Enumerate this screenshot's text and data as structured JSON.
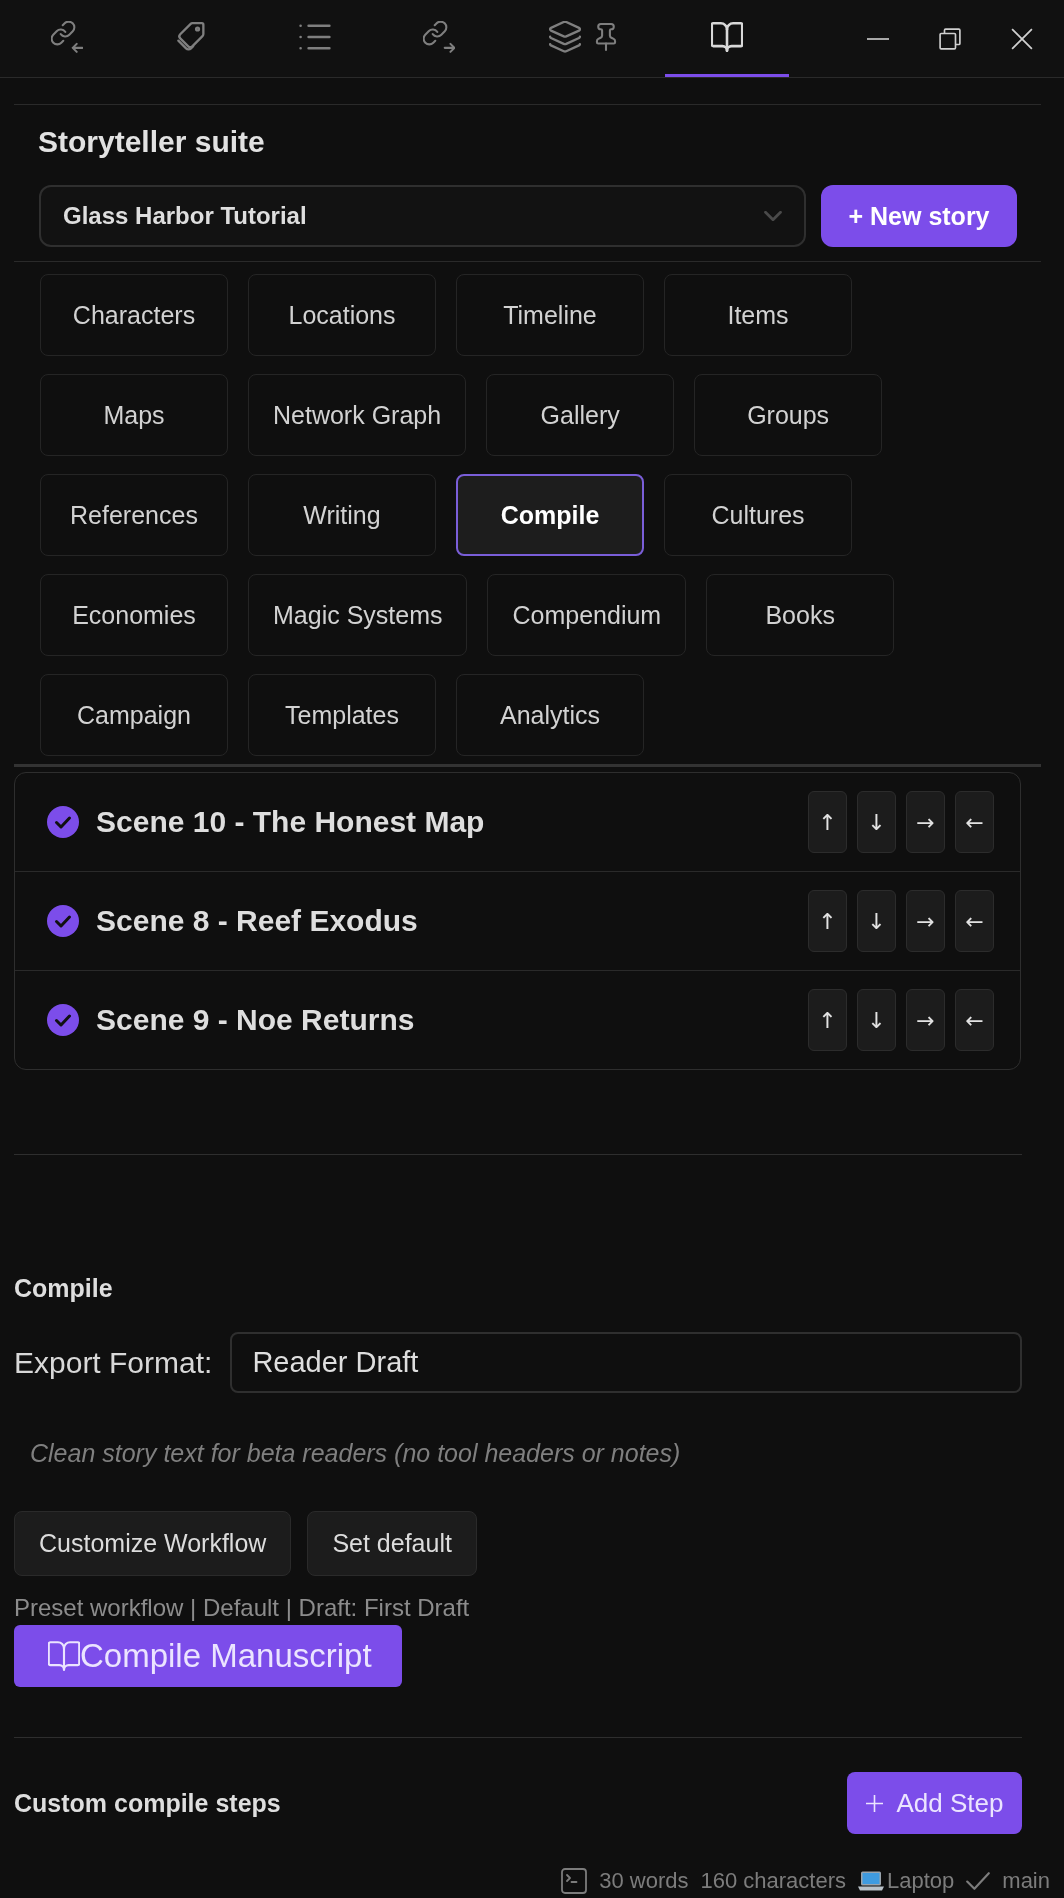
{
  "top_tabs": [
    {
      "kind": "backlinks",
      "selected": false,
      "pinned": false
    },
    {
      "kind": "tags",
      "selected": false,
      "pinned": false
    },
    {
      "kind": "outline",
      "selected": false,
      "pinned": false
    },
    {
      "kind": "outlinks",
      "selected": false,
      "pinned": false
    },
    {
      "kind": "layers",
      "selected": false,
      "pinned": true
    },
    {
      "kind": "book",
      "selected": true,
      "pinned": false
    }
  ],
  "header": {
    "title": "Storyteller suite",
    "story_select": {
      "value": "Glass Harbor Tutorial"
    },
    "new_story_button": "+ New story"
  },
  "views": [
    {
      "label": "Characters",
      "selected": false
    },
    {
      "label": "Locations",
      "selected": false
    },
    {
      "label": "Timeline",
      "selected": false
    },
    {
      "label": "Items",
      "selected": false
    },
    {
      "label": "Maps",
      "selected": false
    },
    {
      "label": "Network Graph",
      "selected": false
    },
    {
      "label": "Gallery",
      "selected": false
    },
    {
      "label": "Groups",
      "selected": false
    },
    {
      "label": "References",
      "selected": false
    },
    {
      "label": "Writing",
      "selected": false
    },
    {
      "label": "Compile",
      "selected": true
    },
    {
      "label": "Cultures",
      "selected": false
    },
    {
      "label": "Economies",
      "selected": false
    },
    {
      "label": "Magic Systems",
      "selected": false
    },
    {
      "label": "Compendium",
      "selected": false
    },
    {
      "label": "Books",
      "selected": false
    },
    {
      "label": "Campaign",
      "selected": false
    },
    {
      "label": "Templates",
      "selected": false
    },
    {
      "label": "Analytics",
      "selected": false
    }
  ],
  "scenes": [
    {
      "title": "Scene 10 - The Honest Map",
      "checked": true,
      "controls": [
        "↑",
        "↓",
        "→",
        "←"
      ]
    },
    {
      "title": "Scene 8 - Reef Exodus",
      "checked": true,
      "controls": [
        "↑",
        "↓",
        "→",
        "←"
      ]
    },
    {
      "title": "Scene 9 - Noe Returns",
      "checked": true,
      "controls": [
        "↑",
        "↓",
        "→",
        "←"
      ]
    }
  ],
  "compile": {
    "heading": "Compile",
    "export_format": {
      "label": "Export Format:",
      "value": "Reader Draft"
    },
    "description": "Clean story text for beta readers (no tool headers or notes)",
    "buttons": [
      "Customize Workflow",
      "Set default"
    ],
    "summary": "Preset workflow | Default | Draft: First Draft",
    "compile_button": "Compile Manuscript"
  },
  "custom_steps": {
    "heading": "Custom compile steps",
    "add_button": "Add Step"
  },
  "status_bar": {
    "words": "30 words",
    "characters": "160 characters",
    "device": "Laptop",
    "branch": "main"
  }
}
